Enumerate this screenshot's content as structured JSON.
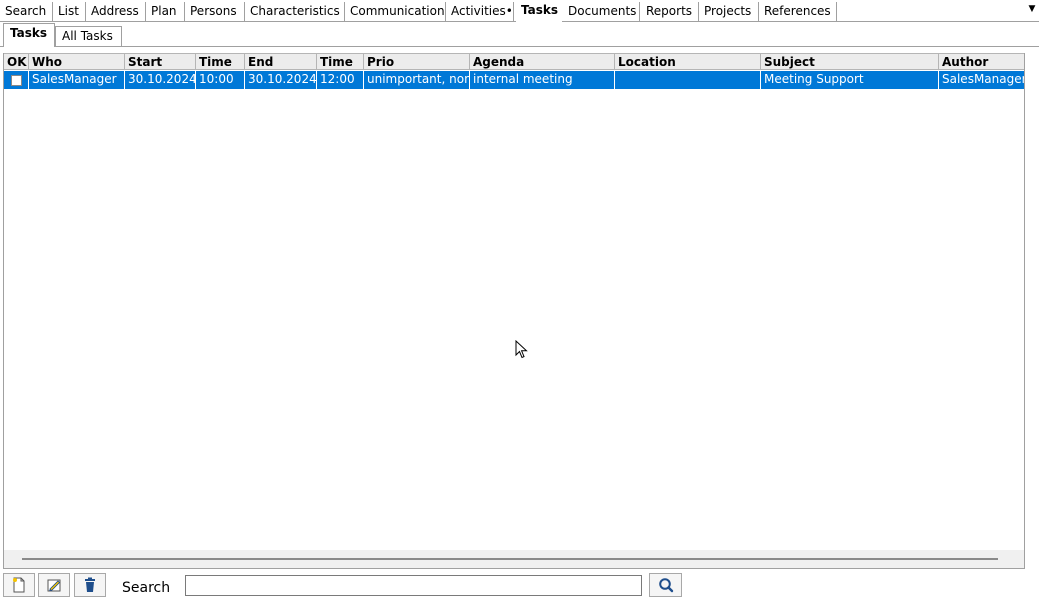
{
  "tabs": [
    {
      "label": "Search"
    },
    {
      "label": "List"
    },
    {
      "label": "Address"
    },
    {
      "label": "Plan"
    },
    {
      "label": "Persons"
    },
    {
      "label": "Characteristics"
    },
    {
      "label": "Communication"
    },
    {
      "label": "Activities•"
    },
    {
      "label": "Tasks"
    },
    {
      "label": "Documents"
    },
    {
      "label": "Reports"
    },
    {
      "label": "Projects"
    },
    {
      "label": "References"
    }
  ],
  "subtabs": [
    {
      "label": "Tasks"
    },
    {
      "label": "All Tasks"
    }
  ],
  "grid": {
    "columns": [
      "OK",
      "Who",
      "Start",
      "Time",
      "End",
      "Time",
      "Prio",
      "Agenda",
      "Location",
      "Subject",
      "Author"
    ],
    "rows": [
      {
        "ok": false,
        "cells": [
          "",
          "SalesManager",
          "30.10.2024",
          "10:00",
          "30.10.2024",
          "12:00",
          "unimportant, non critical",
          "internal meeting",
          "",
          "Meeting Support",
          "SalesManager"
        ]
      }
    ]
  },
  "toolbar": {
    "search_label": "Search",
    "search_value": "",
    "icons": [
      "new-document-icon",
      "edit-icon",
      "delete-icon",
      "search-icon"
    ]
  },
  "colors": {
    "selection": "#0078d7",
    "header_bg": "#ececec",
    "icon_blue": "#1f4e8c"
  }
}
